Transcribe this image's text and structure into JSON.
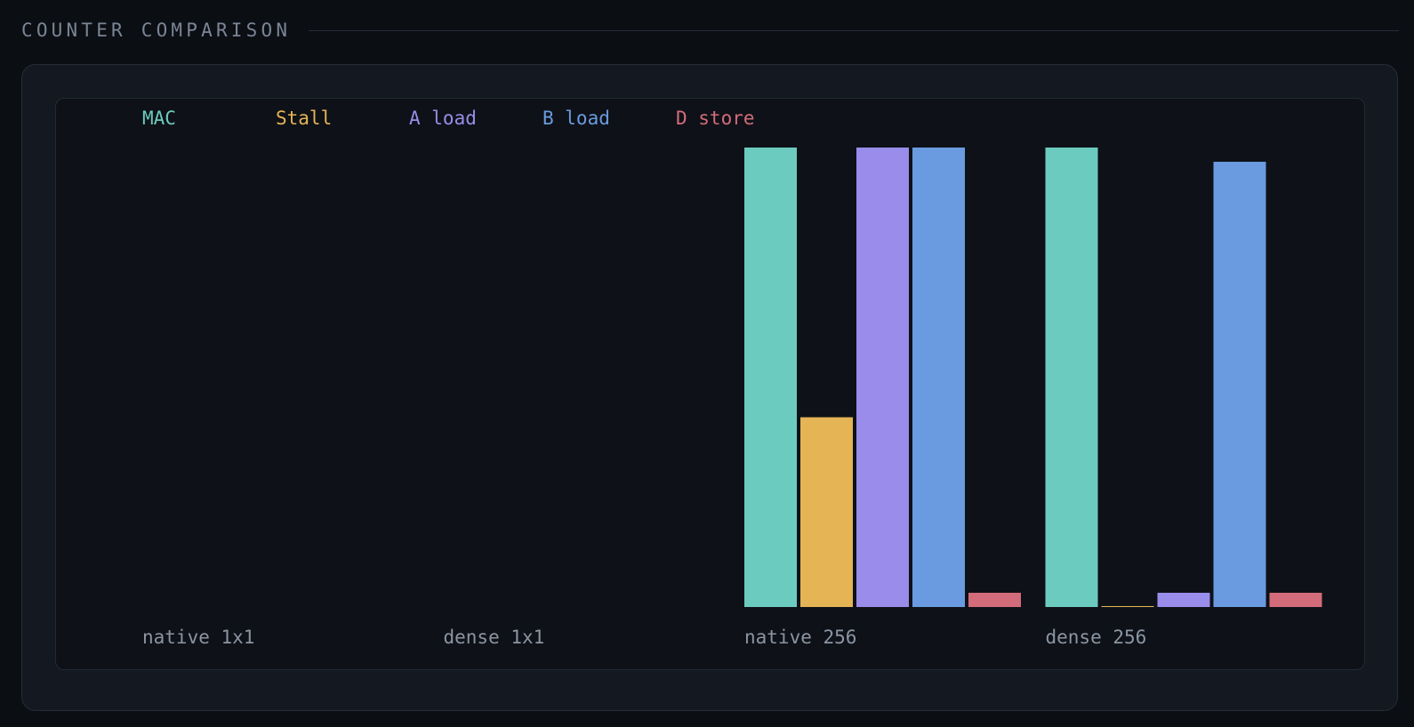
{
  "header": {
    "title": "COUNTER COMPARISON"
  },
  "chart_data": {
    "type": "bar",
    "categories": [
      "native 1x1",
      "dense 1x1",
      "native 256",
      "dense 256"
    ],
    "series": [
      {
        "name": "MAC",
        "color": "#6ccbbf",
        "values": [
          0,
          0,
          100,
          100
        ]
      },
      {
        "name": "Stall",
        "color": "#e4b455",
        "values": [
          0,
          0,
          41.3,
          0.2
        ]
      },
      {
        "name": "A load",
        "color": "#9a8cea",
        "values": [
          0,
          0,
          100,
          3.1
        ]
      },
      {
        "name": "B load",
        "color": "#6a9be0",
        "values": [
          0,
          0,
          100,
          96.9
        ]
      },
      {
        "name": "D store",
        "color": "#d36c7a",
        "values": [
          0,
          0,
          3.1,
          3.1
        ]
      }
    ],
    "ylim": [
      0,
      100
    ],
    "grid": false,
    "legend_position": "top-left",
    "title": "",
    "xlabel": "",
    "ylabel": ""
  }
}
